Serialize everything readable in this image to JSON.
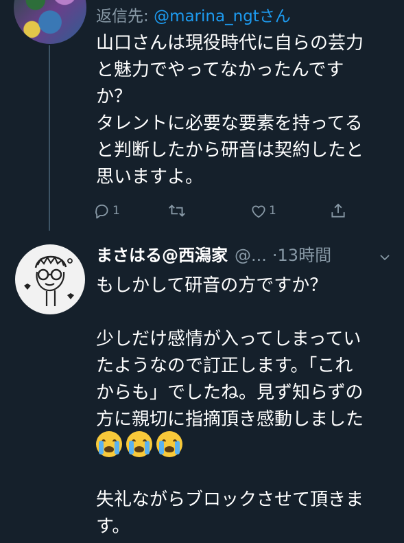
{
  "tweet1": {
    "reply_label": "返信先: ",
    "reply_handle": "@marina_ngtさん",
    "text": "山口さんは現役時代に自らの芸力\nと魅力でやってなかったんです\nか？\nタレントに必要な要素を持ってる\nと判断したから研音は契約したと\n思いますよ。",
    "reply_count": "1",
    "like_count": "1",
    "icons": [
      "reply-icon",
      "retweet-icon",
      "like-icon",
      "share-icon"
    ]
  },
  "tweet2": {
    "name": "まさはる@西潟家",
    "handle": "@...",
    "separator": "·",
    "time": "13時間",
    "text": "もしかして研音の方ですか？\n\n少しだけ感情が入ってしまってい\nたようなので訂正します。「これ\nからも」でしたね。見ず知らずの\n方に親切に指摘頂き感動しました\n\n\n失礼ながらブロックさせて頂きま\nす。",
    "emoji": [
      "loudly-crying-face",
      "loudly-crying-face",
      "loudly-crying-face"
    ],
    "icons": [
      "chevron-down-icon"
    ]
  },
  "colors": {
    "background": "#15202b",
    "text": "#ffffff",
    "secondary": "#8899a6",
    "link": "#1d9bf0",
    "thread_line": "#3d5466"
  }
}
